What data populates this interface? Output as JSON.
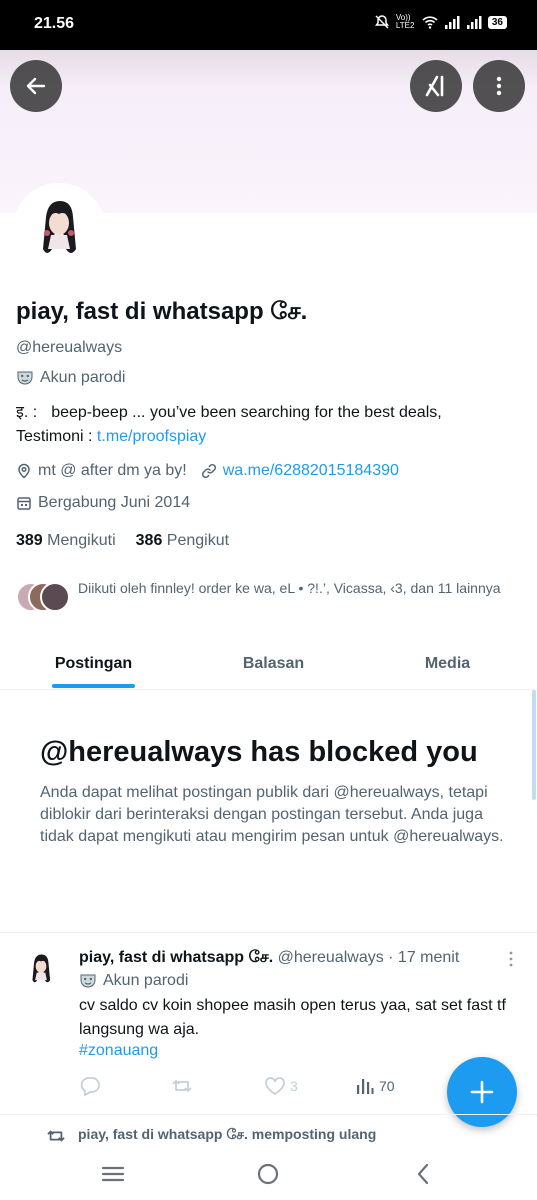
{
  "status_bar": {
    "time": "21.56",
    "net_label": "Vo)) LTE2",
    "battery": "36"
  },
  "profile": {
    "display_name": "piay, fast di whatsapp சே.",
    "handle": "@hereualways",
    "parody_label": "Akun parodi",
    "bio_prefix": "इ. :",
    "bio_text": "beep-beep ... you’ve been searching for the best deals,",
    "bio_line2_label": "Testimoni :",
    "bio_link": "t.me/proofspiay",
    "location": "mt @ after dm ya by!",
    "website": "wa.me/62882015184390",
    "joined": "Bergabung Juni 2014",
    "following_count": "389",
    "following_label": "Mengikuti",
    "followers_count": "386",
    "followers_label": "Pengikut",
    "followed_by": "Diikuti oleh finnley! order ke wa, eL • ?!.’, Vicassa, ‹3, dan 11 lainnya"
  },
  "tabs": [
    {
      "label": "Postingan",
      "active": true
    },
    {
      "label": "Balasan",
      "active": false
    },
    {
      "label": "Media",
      "active": false
    }
  ],
  "blocked": {
    "title": "@hereualways has blocked you",
    "message": "Anda dapat melihat postingan publik dari @hereualways, tetapi diblokir dari berinteraksi dengan postingan tersebut. Anda juga tidak dapat mengikuti atau mengirim pesan untuk @hereualways."
  },
  "tweet": {
    "name": "piay, fast di whatsapp சே.",
    "meta": "@hereualways · 17 menit",
    "parody_label": "Akun parodi",
    "text": "cv saldo cv koin shopee masih open terus yaa, sat set fast tf langsung wa aja.",
    "hashtag": "#zonauang",
    "likes": "3",
    "views": "70"
  },
  "repost_bar": {
    "text": "piay, fast di whatsapp சே. memposting ulang"
  },
  "colors": {
    "accent": "#1d9bf0",
    "text": "#0f1419",
    "muted": "#536471",
    "banner": "#fbf4fc"
  },
  "icons": [
    "back-arrow-icon",
    "grok-icon",
    "more-vertical-icon",
    "parody-mask-icon",
    "location-icon",
    "link-icon",
    "calendar-icon",
    "reply-icon",
    "repost-icon",
    "like-icon",
    "views-icon",
    "plus-icon",
    "menu-icon",
    "home-circle-icon",
    "back-chevron-icon"
  ]
}
